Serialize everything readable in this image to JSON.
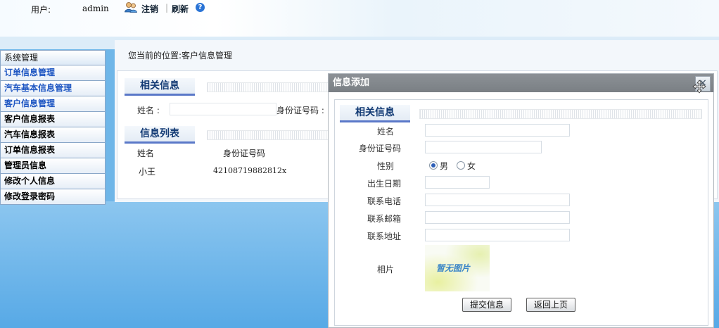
{
  "header": {
    "user_label": "用户:",
    "user_name": "admin",
    "logout": "注销",
    "separator": "|",
    "refresh": "刷新",
    "help_glyph": "?",
    "icons": [
      "user-icon",
      "help-icon"
    ]
  },
  "sidebar": {
    "title": "系统管理",
    "items": [
      {
        "label": "订单信息管理",
        "color": "#1e56c2"
      },
      {
        "label": "汽车基本信息管理",
        "color": "#1e56c2"
      },
      {
        "label": "客户信息管理",
        "color": "#1e56c2"
      },
      {
        "label": "客户信息报表",
        "color": "#000000"
      },
      {
        "label": "汽车信息报表",
        "color": "#000000"
      },
      {
        "label": "订单信息报表",
        "color": "#000000"
      },
      {
        "label": "管理员信息",
        "color": "#000000"
      },
      {
        "label": "修改个人信息",
        "color": "#000000"
      },
      {
        "label": "修改登录密码",
        "color": "#000000"
      }
    ]
  },
  "main": {
    "breadcrumb": "您当前的位置:客户信息管理",
    "search_section": {
      "title": "相关信息",
      "name_label": "姓名 :",
      "id_label": "身份证号码 :"
    },
    "list_section": {
      "title": "信息列表",
      "columns": [
        "姓名",
        "身份证号码"
      ],
      "rows": [
        [
          "小王",
          "42108719882812x"
        ]
      ]
    }
  },
  "dialog": {
    "title": "信息添加",
    "close_glyph": "×",
    "section_title": "相关信息",
    "fields": {
      "name": "姓名",
      "id_number": "身份证号码",
      "gender": "性别",
      "birthdate": "出生日期",
      "phone": "联系电话",
      "email": "联系邮箱",
      "address": "联系地址",
      "photo": "相片"
    },
    "gender_options": [
      "男",
      "女"
    ],
    "gender_selected": "男",
    "photo_placeholder": "暂无图片",
    "submit_label": "提交信息",
    "back_label": "返回上页"
  },
  "colors": {
    "accent": "#5a78c8",
    "dialog_title_bg": "#7a7f84",
    "page_bg": "#6fb6e8"
  }
}
